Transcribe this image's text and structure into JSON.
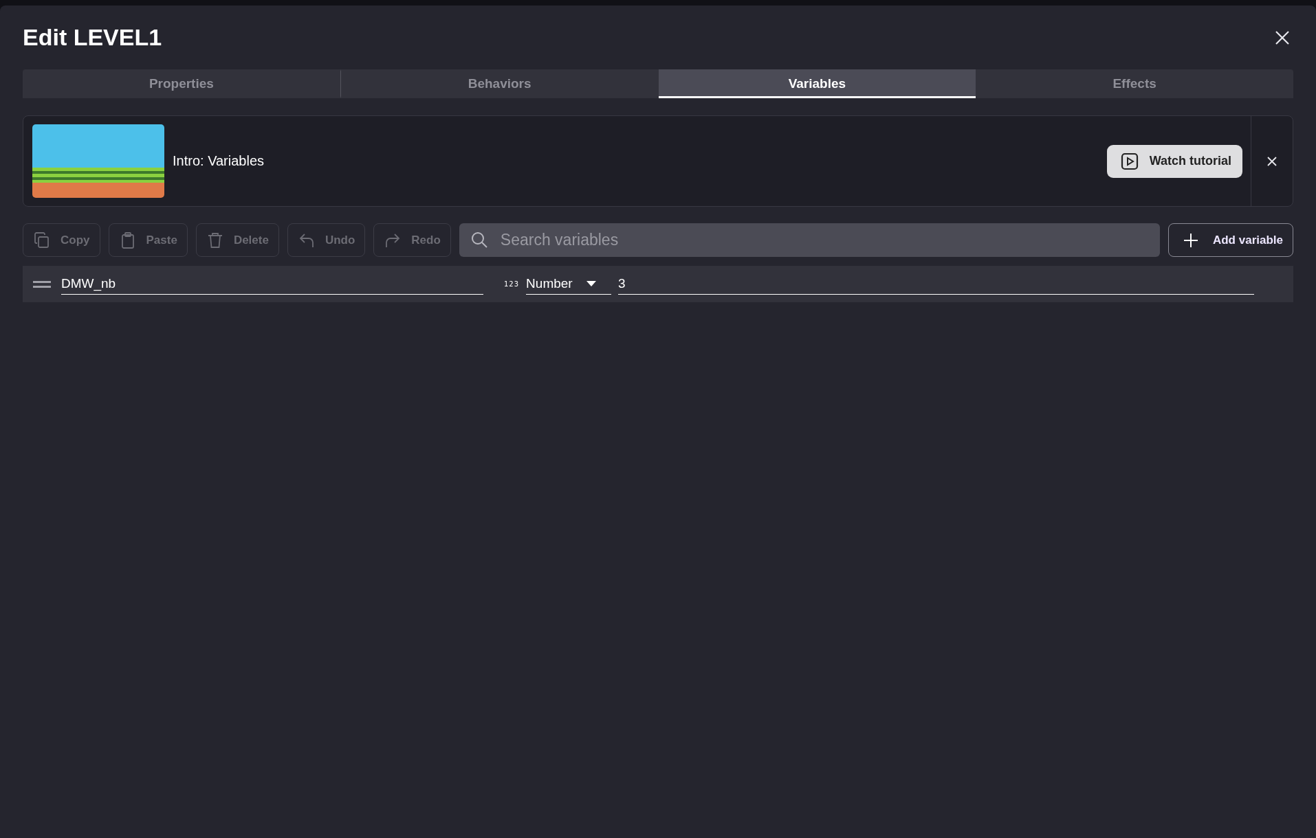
{
  "dialog": {
    "title": "Edit LEVEL1"
  },
  "tabs": [
    {
      "label": "Properties",
      "selected": false
    },
    {
      "label": "Behaviors",
      "selected": false
    },
    {
      "label": "Variables",
      "selected": true
    },
    {
      "label": "Effects",
      "selected": false
    }
  ],
  "tutorial": {
    "title": "Intro: Variables",
    "button": "Watch tutorial"
  },
  "toolbar": [
    {
      "kind": "copy",
      "label": "Copy",
      "disabled": true
    },
    {
      "kind": "paste",
      "label": "Paste",
      "disabled": true
    },
    {
      "kind": "delete",
      "label": "Delete",
      "disabled": true
    },
    {
      "kind": "undo",
      "label": "Undo",
      "disabled": true
    },
    {
      "kind": "redo",
      "label": "Redo",
      "disabled": true
    }
  ],
  "search": {
    "placeholder": "Search variables"
  },
  "add_button": "Add variable",
  "variables": [
    {
      "name": "DMW_nb",
      "type_badge": "123",
      "type": "Number",
      "value": "3"
    }
  ]
}
